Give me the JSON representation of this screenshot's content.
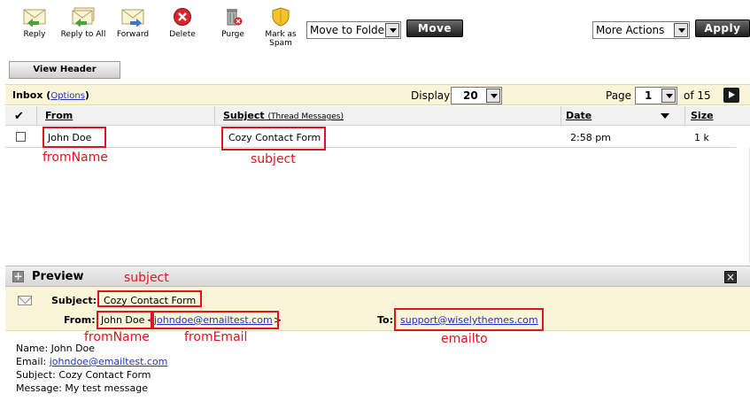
{
  "toolbar": {
    "buttons": [
      {
        "label": "Reply",
        "icon": "reply-envelope-icon"
      },
      {
        "label": "Reply to All",
        "icon": "reply-all-envelope-icon"
      },
      {
        "label": "Forward",
        "icon": "forward-envelope-icon"
      },
      {
        "label": "Delete",
        "icon": "delete-x-icon"
      },
      {
        "label": "Purge",
        "icon": "purge-trash-icon"
      },
      {
        "label": "Mark as Spam",
        "icon": "spam-shield-icon"
      }
    ],
    "move_select": "Move to Folder",
    "move_button": "Move",
    "actions_select": "More Actions",
    "apply_button": "Apply",
    "view_header_button": "View Header"
  },
  "inbox": {
    "title": "Inbox",
    "options_link": "Options",
    "display_label": "Display",
    "display_value": "20",
    "page_label": "Page",
    "page_value": "1",
    "page_total": "of 15"
  },
  "columns": {
    "from": "From",
    "subject": "Subject",
    "thread_link": "(Thread Messages)",
    "date": "Date",
    "size": "Size"
  },
  "messages": [
    {
      "from": "John Doe",
      "subject": "Cozy Contact Form",
      "date": "2:58 pm",
      "size": "1 k"
    }
  ],
  "annotations": {
    "list_from": "fromName",
    "list_subject": "subject",
    "preview_subject": "subject",
    "preview_from_name": "fromName",
    "preview_from_email": "fromEmail",
    "preview_to": "emailto"
  },
  "preview": {
    "title": "Preview",
    "subject_label": "Subject:",
    "subject_value": "Cozy Contact Form",
    "from_label": "From:",
    "from_name": "John Doe",
    "from_open": "<",
    "from_email": "johndoe@emailtest.com",
    "from_close": ">",
    "to_label": "To:",
    "to_email": "support@wiselythemes.com",
    "body": {
      "name_line": "Name: John Doe",
      "email_prefix": "Email: ",
      "email_link": "johndoe@emailtest.com",
      "subject_line": "Subject: Cozy Contact Form",
      "message_line": "Message: My test message"
    }
  },
  "colors": {
    "annotation_red": "#e0141e",
    "link_blue": "#1c34c4",
    "highlight_yellow": "#faf5d8"
  }
}
